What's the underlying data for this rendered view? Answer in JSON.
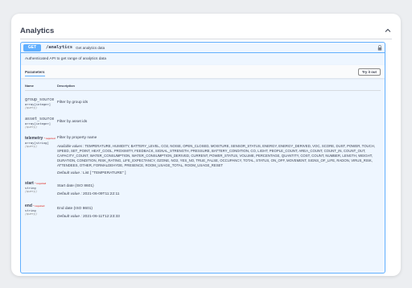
{
  "section": {
    "title": "Analytics",
    "chevron": "chevron-up-icon"
  },
  "operation": {
    "method": "GET",
    "path": "/analytics",
    "summary": "Get analytics data",
    "lock_icon": "lock-icon",
    "description": "Authenticated API to get range of analytics data"
  },
  "tabs": {
    "parameters": "Parameters",
    "try_it_out": "Try it out"
  },
  "table_headers": {
    "name": "Name",
    "description": "Description"
  },
  "params": [
    {
      "name": "group_source",
      "required": "",
      "type": "array[integer]",
      "in": "(query)",
      "description": "Filter by group ids"
    },
    {
      "name": "asset_source",
      "required": "",
      "type": "array[integer]",
      "in": "(query)",
      "description": "Filter by asset ids"
    },
    {
      "name": "telemetry",
      "required": "* required",
      "type": "array[string]",
      "in": "(query)",
      "description": "Filter by property name",
      "available_label": "Available values :",
      "available_values": "TEMPERATURE, HUMIDITY, BATTERY_LEVEL, CO2, NOISE, OPEN_CLOSED, MOISTURE, SENSOR_STATUS, ENERGY, ENERGY_DERIVED, VOC, SCORE, DUST, POWER, TOUCH, SPEED, SET_POINT, HEAT_COOL, PROXIMITY, FEEDBACK, SIGNAL_STRENGTH, PRESSURE, BATTERY_CONDITION, CO, LIGHT, PEOPLE_COUNT, AREA_COUNT, COUNT_IN, COUNT_OUT, CAPACITY_COUNT, WATER_CONSUMPTION, WATER_CONSUMPTION_DERIVED, CURRENT, POWER_STATUS, VOLUME, PERCENTAGE, QUANTITY, COST, COUNT, NUMBER, LENGTH, WEIGHT, DURATION, CONDITION, RISK_RATING, LIFE_EXPECTANCY, OZONE, NO2, YES_NO, TRUE_FALSE, OCCUPANCY, TOTAL, STATUS, ON_OFF, MOVEMENT, SIGNS_OF_LIFE, RADON, VIRUS_RISK, ATTENDEES, OTHER, FORMALDEHYDE, PRESENCE, ROOM_USAGE_TOTAL, ROOM_USAGE_RESET",
      "default_label": "Default value :",
      "default_value": "List [ \"TEMPERATURE\" ]"
    },
    {
      "name": "start",
      "required": "* required",
      "type": "string",
      "in": "(query)",
      "description": "Start date (ISO 8601)",
      "default_label": "Default value :",
      "default_value": "2021-06-09T11:22:11"
    },
    {
      "name": "end",
      "required": "* required",
      "type": "string",
      "in": "(query)",
      "description": "End date (ISO 8601)",
      "default_label": "Default value :",
      "default_value": "2021-06-11T12:23:33"
    }
  ]
}
